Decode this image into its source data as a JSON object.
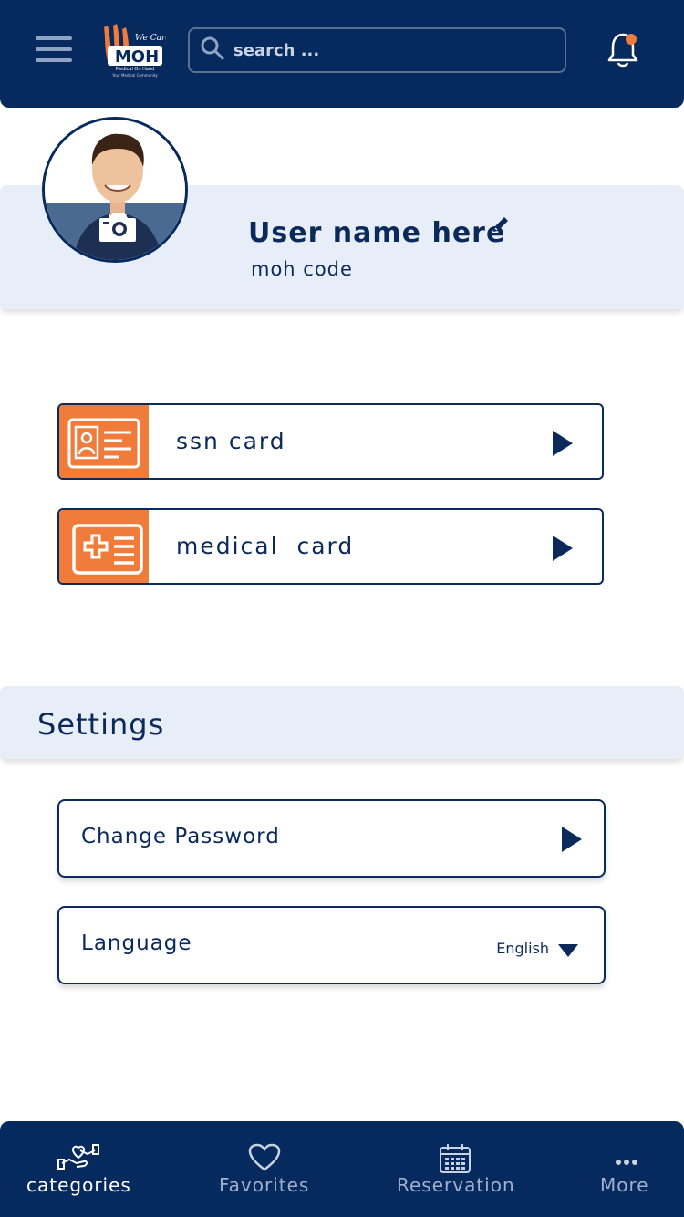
{
  "header": {
    "search_placeholder": "search ...",
    "logo_text": "MOH",
    "logo_tagline": "We Care",
    "logo_subtext": "Medical On Hand",
    "notification_dot_color": "#f07c3b"
  },
  "profile": {
    "user_name": "User name here",
    "code": "moh code"
  },
  "cards": [
    {
      "label": "ssn card",
      "icon": "id-card-icon"
    },
    {
      "label": "medical  card",
      "icon": "medical-card-icon"
    }
  ],
  "settings": {
    "title": "Settings",
    "change_password": "Change Password",
    "language_label": "Language",
    "language_value": "English"
  },
  "nav": [
    {
      "label": "categories",
      "icon": "categories-icon",
      "active": true
    },
    {
      "label": "Favorites",
      "icon": "heart-icon",
      "active": false
    },
    {
      "label": "Reservation",
      "icon": "calendar-icon",
      "active": false
    },
    {
      "label": "More",
      "icon": "more-icon",
      "active": false
    }
  ],
  "colors": {
    "primary": "#062a5e",
    "accent": "#f07c3b",
    "band": "#e8eef7"
  }
}
